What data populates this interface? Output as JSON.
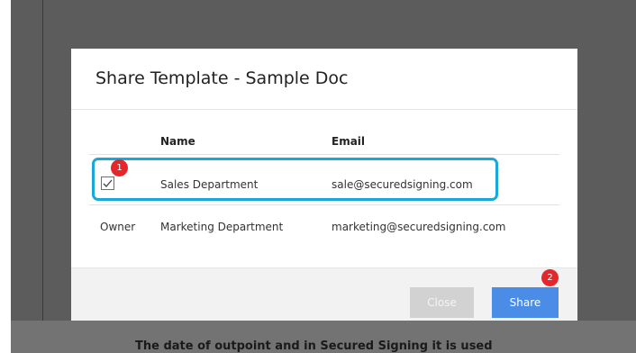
{
  "background": {
    "footer_text": "The date of outpoint and in Secured Signing it is used"
  },
  "dialog": {
    "title": "Share Template - Sample Doc",
    "columns": {
      "name": "Name",
      "email": "Email"
    },
    "rows": [
      {
        "status": "",
        "checked": true,
        "name": "Sales Department",
        "email": "sale@securedsigning.com",
        "highlighted": true
      },
      {
        "status": "Owner",
        "checked": false,
        "name": "Marketing Department",
        "email": "marketing@securedsigning.com",
        "highlighted": false
      }
    ],
    "buttons": {
      "close": "Close",
      "share": "Share"
    }
  },
  "annotations": {
    "badge_1": "1",
    "badge_2": "2",
    "highlight_color": "#1aa7da",
    "badge_color": "#e5262b"
  },
  "colors": {
    "share_button": "#4b8de6",
    "close_button_disabled": "#d2d2d2"
  }
}
